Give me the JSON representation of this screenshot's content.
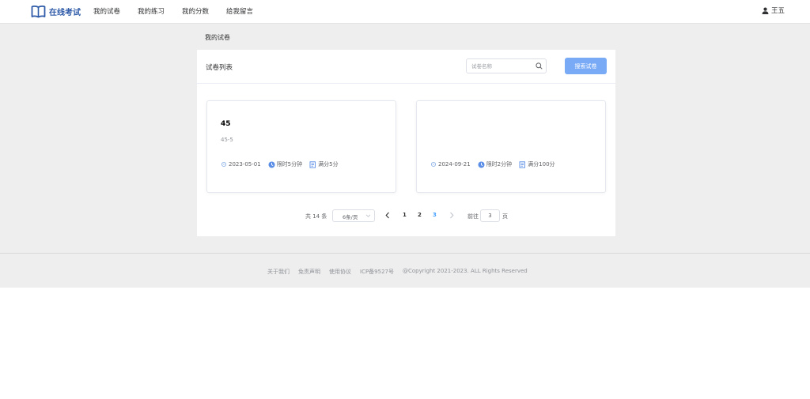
{
  "header": {
    "logo_text": "在线考试",
    "nav": [
      "我的试卷",
      "我的练习",
      "我的分数",
      "给我留言"
    ],
    "user": "王五"
  },
  "breadcrumb": "我的试卷",
  "panel": {
    "title": "试卷列表",
    "search_placeholder": "试卷名称",
    "search_button": "搜索试卷"
  },
  "cards": [
    {
      "title": "45",
      "desc": "45-5",
      "date": "2023-05-01",
      "time_limit": "限时5分钟",
      "full_score": "满分5分"
    },
    {
      "title": "",
      "desc": "",
      "date": "2024-09-21",
      "time_limit": "限时2分钟",
      "full_score": "满分100分"
    }
  ],
  "pagination": {
    "total": "共 14 条",
    "page_size": "6条/页",
    "pages": [
      "1",
      "2",
      "3"
    ],
    "current": "3",
    "goto_label": "前往",
    "goto_value": "3",
    "page_suffix": "页"
  },
  "footer": {
    "links": [
      "关于我们",
      "免责声明",
      "使用协议",
      "ICP备9527号",
      "@Copyright 2021-2023. ALL Rights Reserved"
    ]
  },
  "colors": {
    "brand": "#2e5aa8",
    "primary_button": "#79aaf5",
    "active_page": "#409eff",
    "background": "#eeeeee"
  },
  "icons": [
    "book-logo-icon",
    "user-icon",
    "search-icon",
    "calendar-icon",
    "clock-icon",
    "score-icon",
    "chevron-left-icon",
    "chevron-right-icon",
    "chevron-down-icon"
  ]
}
